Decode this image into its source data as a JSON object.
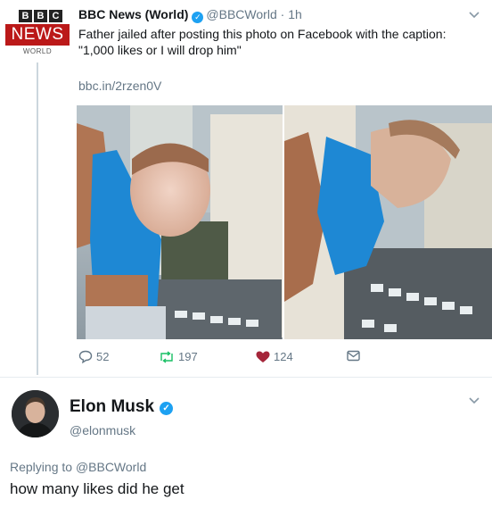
{
  "tweet": {
    "author_name": "BBC News (World)",
    "author_handle": "@BBCWorld",
    "separator": "·",
    "time": "1h",
    "logo": {
      "bbc_letters": [
        "B",
        "B",
        "C"
      ],
      "news_label": "NEWS",
      "world_label": "WORLD"
    },
    "text_line1": "Father jailed after posting this photo on Facebook with the caption:",
    "text_line2": "\"1,000 likes or I will drop him\"",
    "link": "bbc.in/2rzen0V",
    "actions": {
      "replies": "52",
      "retweets": "197",
      "likes": "124"
    }
  },
  "reply": {
    "author_name": "Elon Musk",
    "author_handle": "@elonmusk",
    "replying_to_prefix": "Replying to",
    "replying_to_handle": "@BBCWorld",
    "text": "how many likes did he get"
  },
  "colors": {
    "bbc_red": "#bb1919",
    "verified_blue": "#1da1f2",
    "like_heart": "#e0245e",
    "muted_text": "#657786",
    "retweet_green": "#17bf63"
  },
  "icons": [
    "verified-badge-icon",
    "chevron-down-icon",
    "reply-icon",
    "retweet-icon",
    "heart-icon",
    "direct-message-icon"
  ]
}
